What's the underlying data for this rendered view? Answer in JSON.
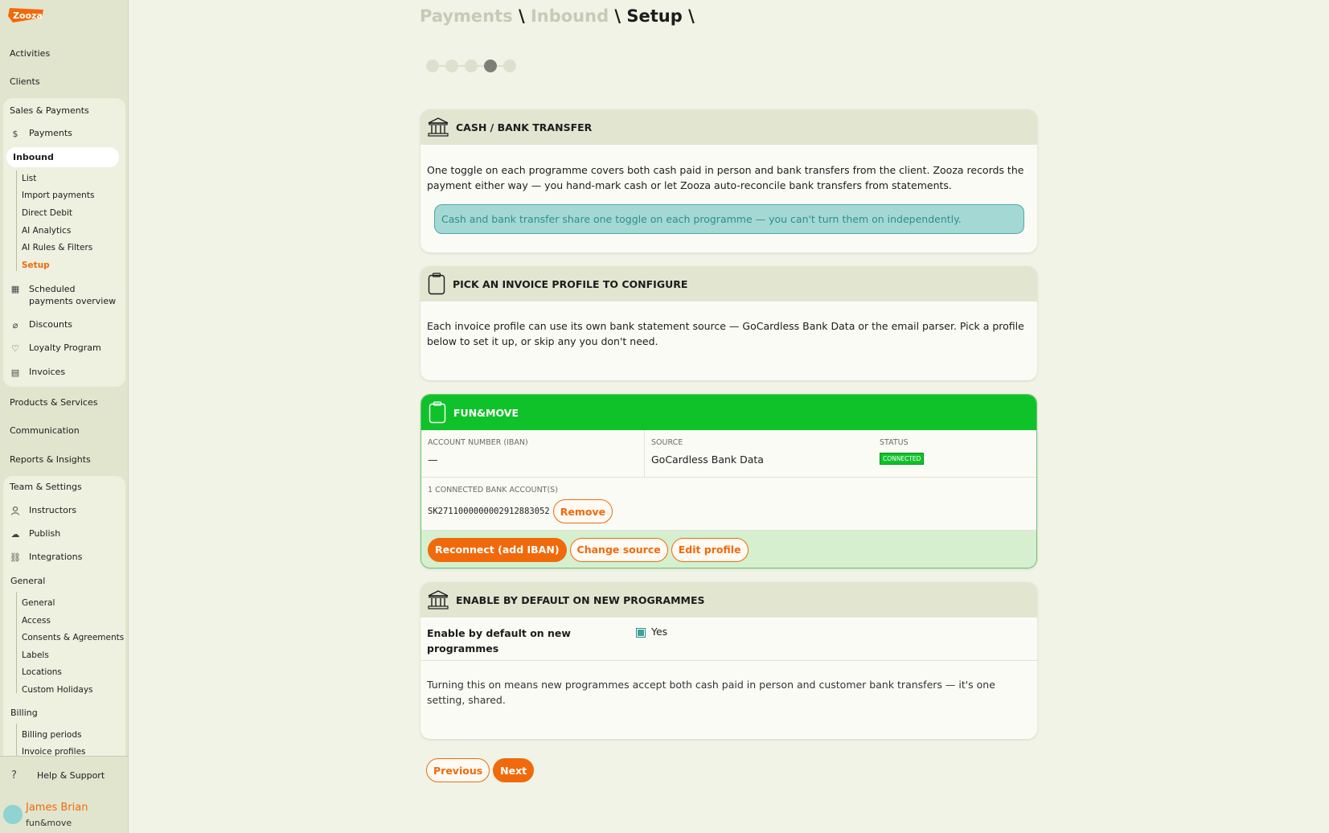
{
  "sidebar": {
    "logo_text": "Zooza",
    "top_items": [
      {
        "label": "Activities"
      },
      {
        "label": "Clients"
      }
    ],
    "sales_group": {
      "title": "Sales & Payments",
      "payments": {
        "label": "Payments",
        "icon": "dollar-icon"
      },
      "inbound": {
        "label": "Inbound"
      },
      "inbound_sub": [
        {
          "label": "List"
        },
        {
          "label": "Import payments"
        },
        {
          "label": "Direct Debit"
        },
        {
          "label": "AI Analytics"
        },
        {
          "label": "AI Rules & Filters"
        },
        {
          "label": "Setup"
        }
      ],
      "items": [
        {
          "label": "Scheduled payments overview",
          "icon": "calendar-icon"
        },
        {
          "label": "Discounts",
          "icon": "tag-icon"
        },
        {
          "label": "Loyalty Program",
          "icon": "heart-icon"
        },
        {
          "label": "Invoices",
          "icon": "invoice-icon"
        }
      ]
    },
    "middle_items": [
      {
        "label": "Products & Services"
      },
      {
        "label": "Communication"
      },
      {
        "label": "Reports & Insights"
      }
    ],
    "team_group": {
      "title": "Team & Settings",
      "items": [
        {
          "label": "Instructors",
          "icon": "user-icon"
        },
        {
          "label": "Publish",
          "icon": "cloud-upload-icon"
        },
        {
          "label": "Integrations",
          "icon": "link-icon"
        }
      ],
      "general": {
        "label": "General"
      },
      "general_sub": [
        {
          "label": "General"
        },
        {
          "label": "Access"
        },
        {
          "label": "Consents & Agreements"
        },
        {
          "label": "Labels"
        },
        {
          "label": "Locations"
        },
        {
          "label": "Custom Holidays"
        }
      ],
      "billing": {
        "label": "Billing"
      },
      "billing_sub": [
        {
          "label": "Billing periods"
        },
        {
          "label": "Invoice profiles"
        }
      ]
    },
    "footer": {
      "help_label": "Help & Support",
      "user_name": "James Brian",
      "user_org": "fun&move"
    }
  },
  "breadcrumb": {
    "items": [
      "Payments",
      "Inbound",
      "Setup"
    ],
    "separator": "\\"
  },
  "stepper": {
    "total": 5,
    "current": 4
  },
  "cash_card": {
    "title": "CASH / BANK TRANSFER",
    "icon": "bank-icon",
    "description": "One toggle on each programme covers both cash paid in person and bank transfers from the client. Zooza records the payment either way — you hand-mark cash or let Zooza auto-reconcile bank transfers from statements.",
    "notice": "Cash and bank transfer share one toggle on each programme — you can't turn them on independently."
  },
  "profile_card": {
    "title": "PICK AN INVOICE PROFILE TO CONFIGURE",
    "icon": "clipboard-icon",
    "description": "Each invoice profile can use its own bank statement source — GoCardless Bank Data or the email parser. Pick a profile below to set it up, or skip any you don't need."
  },
  "funmove_card": {
    "title": "FUN&MOVE",
    "icon": "clipboard-icon",
    "account_label": "ACCOUNT NUMBER (IBAN)",
    "account_value": "—",
    "source_label": "SOURCE",
    "source_value": "GoCardless Bank Data",
    "status_label": "STATUS",
    "status_value": "CONNECTED",
    "connected_label": "1 CONNECTED BANK ACCOUNT(S)",
    "connected_account": "SK2711000000002912883052",
    "remove_label": "Remove",
    "reconnect_label": "Reconnect (add IBAN)",
    "change_source_label": "Change source",
    "edit_profile_label": "Edit profile",
    "colors": {
      "header": "#10c22a",
      "action_bar": "#d5efcf",
      "accent": "#f06a0b"
    }
  },
  "default_card": {
    "title": "ENABLE BY DEFAULT ON NEW PROGRAMMES",
    "icon": "bank-icon",
    "toggle_label": "Enable by default on new programmes",
    "toggle_value_label": "Yes",
    "toggle_checked": true,
    "description": "Turning this on means new programmes accept both cash paid in person and customer bank transfers — it's one setting, shared."
  },
  "footer_buttons": {
    "previous_label": "Previous",
    "next_label": "Next"
  }
}
